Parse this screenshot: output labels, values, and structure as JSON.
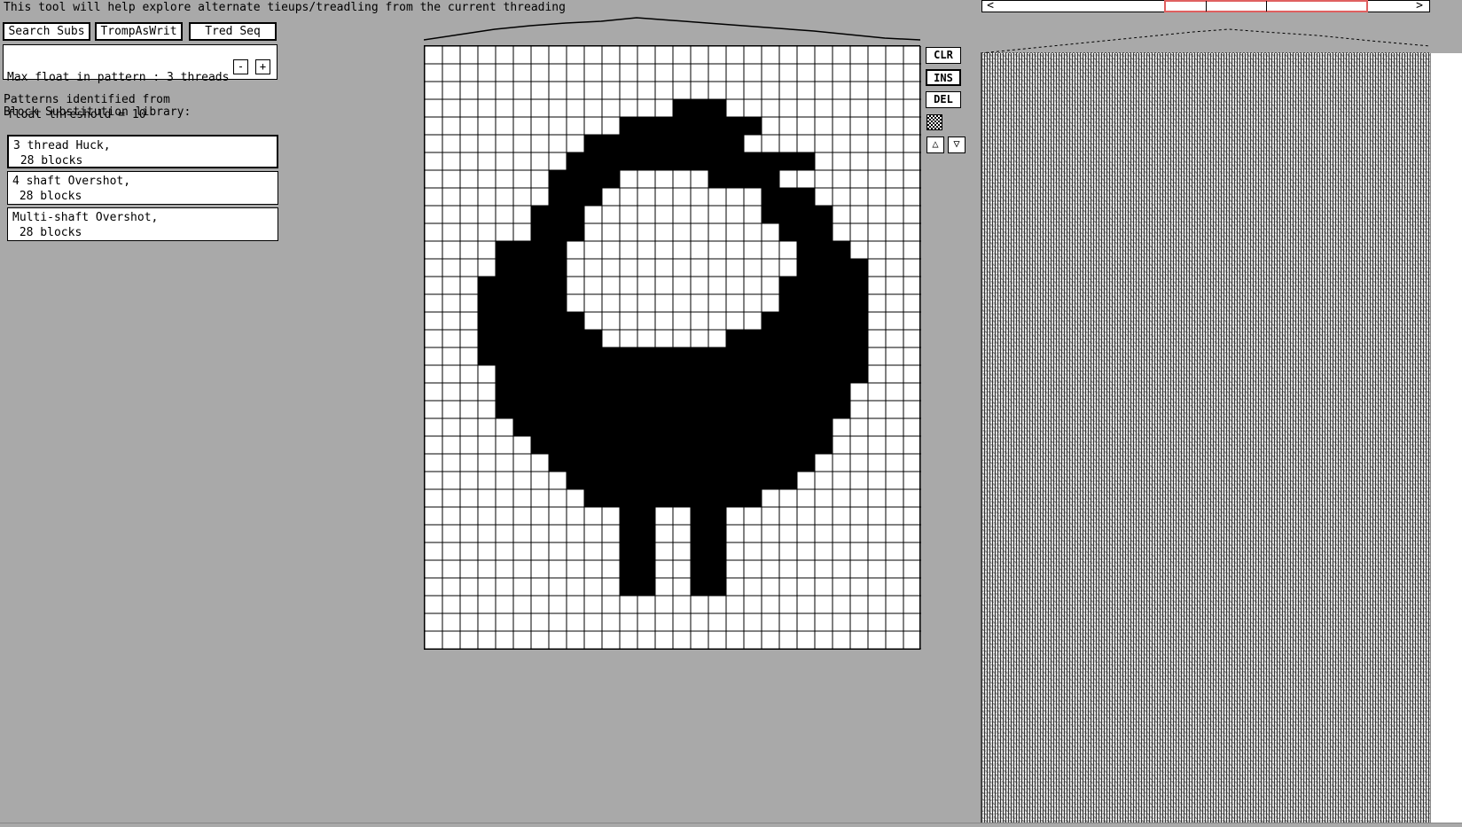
{
  "intro": "This tool will help explore alternate tieups/treadling from the current threading",
  "toolbar": {
    "search_subs": "Search Subs",
    "tromp": "TrompAsWrit",
    "tred_seq": "Tred Seq"
  },
  "float_panel": {
    "line1": "Max float in pattern : 3 threads",
    "line2": "float threshold = 10",
    "minus": "-",
    "plus": "+"
  },
  "library": {
    "heading1": "Patterns identified from",
    "heading2": "Block Substitution library:",
    "items": [
      {
        "label": "3 thread Huck,\n 28 blocks"
      },
      {
        "label": "4 shaft Overshot,\n 28 blocks"
      },
      {
        "label": "Multi-shaft Overshot,\n 28 blocks"
      }
    ]
  },
  "side": {
    "clr": "CLR",
    "ins": "INS",
    "del": "DEL",
    "up": "△",
    "down": "▽"
  },
  "scroll": {
    "left": "<",
    "right": ">"
  },
  "pattern_rows": [
    "............................",
    "............................",
    "............................",
    "..............###...........",
    "...........*#######.........",
    ".........#########..........",
    "........##############......",
    ".......####.....####........",
    ".......###.........###......",
    "......###..........####.....",
    "......###...........###.....",
    "....####.............###....",
    "....####.............####...",
    "...#####............#####...",
    "...#####............#####...",
    "...######..........######...",
    "...#######.......########...",
    "...######################...",
    "....#####################...",
    "....####################....",
    "....####################....",
    ".....##################.....",
    "......#################.....",
    ".......###############......",
    "........#############.......",
    ".........##########.........",
    "...........##..##...........",
    "...........##..##...........",
    "...........##..##...........",
    "...........##..##...........",
    "...........##..##...........",
    "............................",
    "............................",
    "............................"
  ],
  "colors": {
    "background": "#a9a9a9",
    "grid_fill": "#000000",
    "accent_red": "#e06060"
  }
}
